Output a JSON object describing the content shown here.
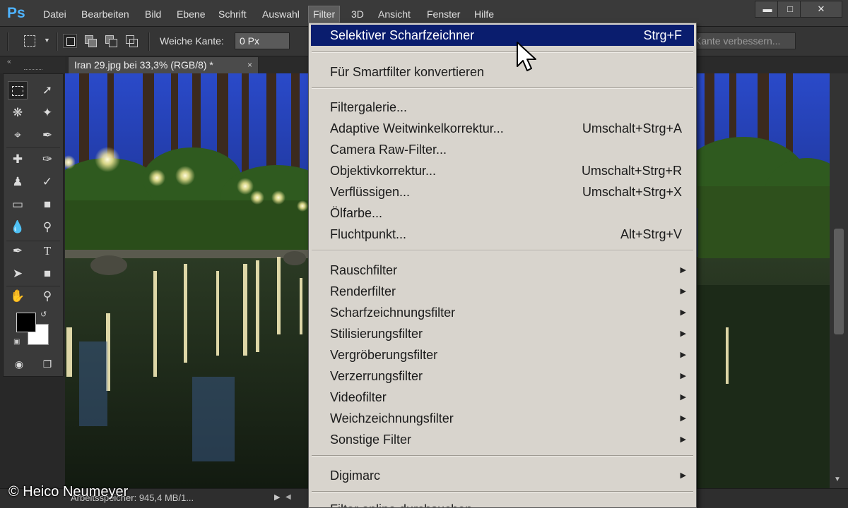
{
  "menubar": {
    "logo": "Ps",
    "items": [
      "Datei",
      "Bearbeiten",
      "Bild",
      "Ebene",
      "Schrift",
      "Auswahl",
      "Filter",
      "3D",
      "Ansicht",
      "Fenster",
      "Hilfe"
    ],
    "active_item": "Filter",
    "window_buttons": [
      "minimize-icon",
      "maximize-icon",
      "close-icon"
    ]
  },
  "options": {
    "feather_label": "Weiche Kante:",
    "feather_value": "0 Px",
    "refine_edge_label": "Kante verbessern..."
  },
  "document": {
    "tab_title": "Iran 29.jpg bei 33,3% (RGB/8) *",
    "tab_close": "×"
  },
  "status": {
    "text": "Arbeitsspeicher: 945,4 MB/1...",
    "copyright": "© Heico Neumeyer"
  },
  "filter_menu": {
    "top": [
      {
        "label": "Selektiver Scharfzeichner",
        "shortcut": "Strg+F",
        "highlighted": true
      }
    ],
    "smart": [
      {
        "label": "Für Smartfilter konvertieren",
        "shortcut": ""
      }
    ],
    "filters": [
      {
        "label": "Filtergalerie...",
        "shortcut": ""
      },
      {
        "label": "Adaptive Weitwinkelkorrektur...",
        "shortcut": "Umschalt+Strg+A"
      },
      {
        "label": "Camera Raw-Filter...",
        "shortcut": ""
      },
      {
        "label": "Objektivkorrektur...",
        "shortcut": "Umschalt+Strg+R"
      },
      {
        "label": "Verflüssigen...",
        "shortcut": "Umschalt+Strg+X"
      },
      {
        "label": "Ölfarbe...",
        "shortcut": ""
      },
      {
        "label": "Fluchtpunkt...",
        "shortcut": "Alt+Strg+V"
      }
    ],
    "submenus": [
      {
        "label": "Rauschfilter"
      },
      {
        "label": "Renderfilter"
      },
      {
        "label": "Scharfzeichnungsfilter"
      },
      {
        "label": "Stilisierungsfilter"
      },
      {
        "label": "Vergröberungsfilter"
      },
      {
        "label": "Verzerrungsfilter"
      },
      {
        "label": "Videofilter"
      },
      {
        "label": "Weichzeichnungsfilter"
      },
      {
        "label": "Sonstige Filter"
      }
    ],
    "digimarc": {
      "label": "Digimarc"
    },
    "online": {
      "label": "Filter online durchsuchen..."
    }
  },
  "colors": {
    "highlight": "#0a1d6e",
    "menu_bg": "#d8d4cd",
    "ui_dark": "#3a3a3a"
  }
}
